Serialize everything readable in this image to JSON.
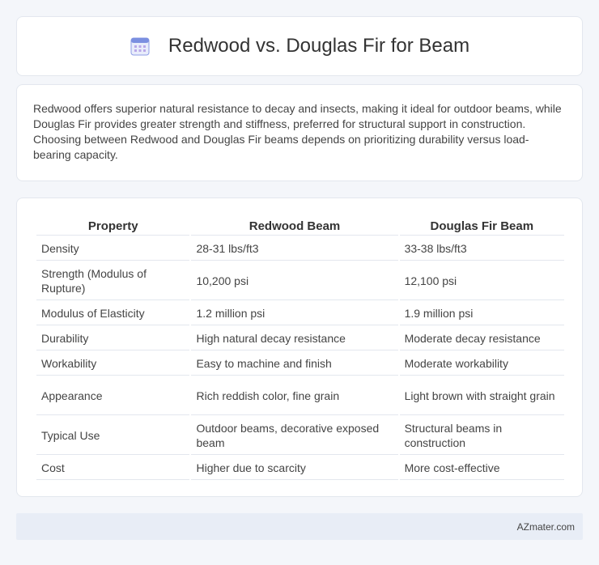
{
  "header": {
    "title": "Redwood vs. Douglas Fir for Beam",
    "icon": "calendar-icon"
  },
  "summary": {
    "text": "Redwood offers superior natural resistance to decay and insects, making it ideal for outdoor beams, while Douglas Fir provides greater strength and stiffness, preferred for structural support in construction. Choosing between Redwood and Douglas Fir beams depends on prioritizing durability versus load-bearing capacity."
  },
  "table": {
    "headers": [
      "Property",
      "Redwood Beam",
      "Douglas Fir Beam"
    ],
    "rows": [
      [
        "Density",
        "28-31 lbs/ft3",
        "33-38 lbs/ft3"
      ],
      [
        "Strength (Modulus of Rupture)",
        "10,200 psi",
        "12,100 psi"
      ],
      [
        "Modulus of Elasticity",
        "1.2 million psi",
        "1.9 million psi"
      ],
      [
        "Durability",
        "High natural decay resistance",
        "Moderate decay resistance"
      ],
      [
        "Workability",
        "Easy to machine and finish",
        "Moderate workability"
      ],
      [
        "Appearance",
        "Rich reddish color, fine grain",
        "Light brown with straight grain"
      ],
      [
        "Typical Use",
        "Outdoor beams, decorative exposed beam",
        "Structural beams in construction"
      ],
      [
        "Cost",
        "Higher due to scarcity",
        "More cost-effective"
      ]
    ]
  },
  "footer": {
    "source": "AZmater.com"
  },
  "colors": {
    "background": "#f4f6fa",
    "card": "#ffffff",
    "footer": "#e8edf6",
    "icon_accent": "#7b8fe0"
  }
}
